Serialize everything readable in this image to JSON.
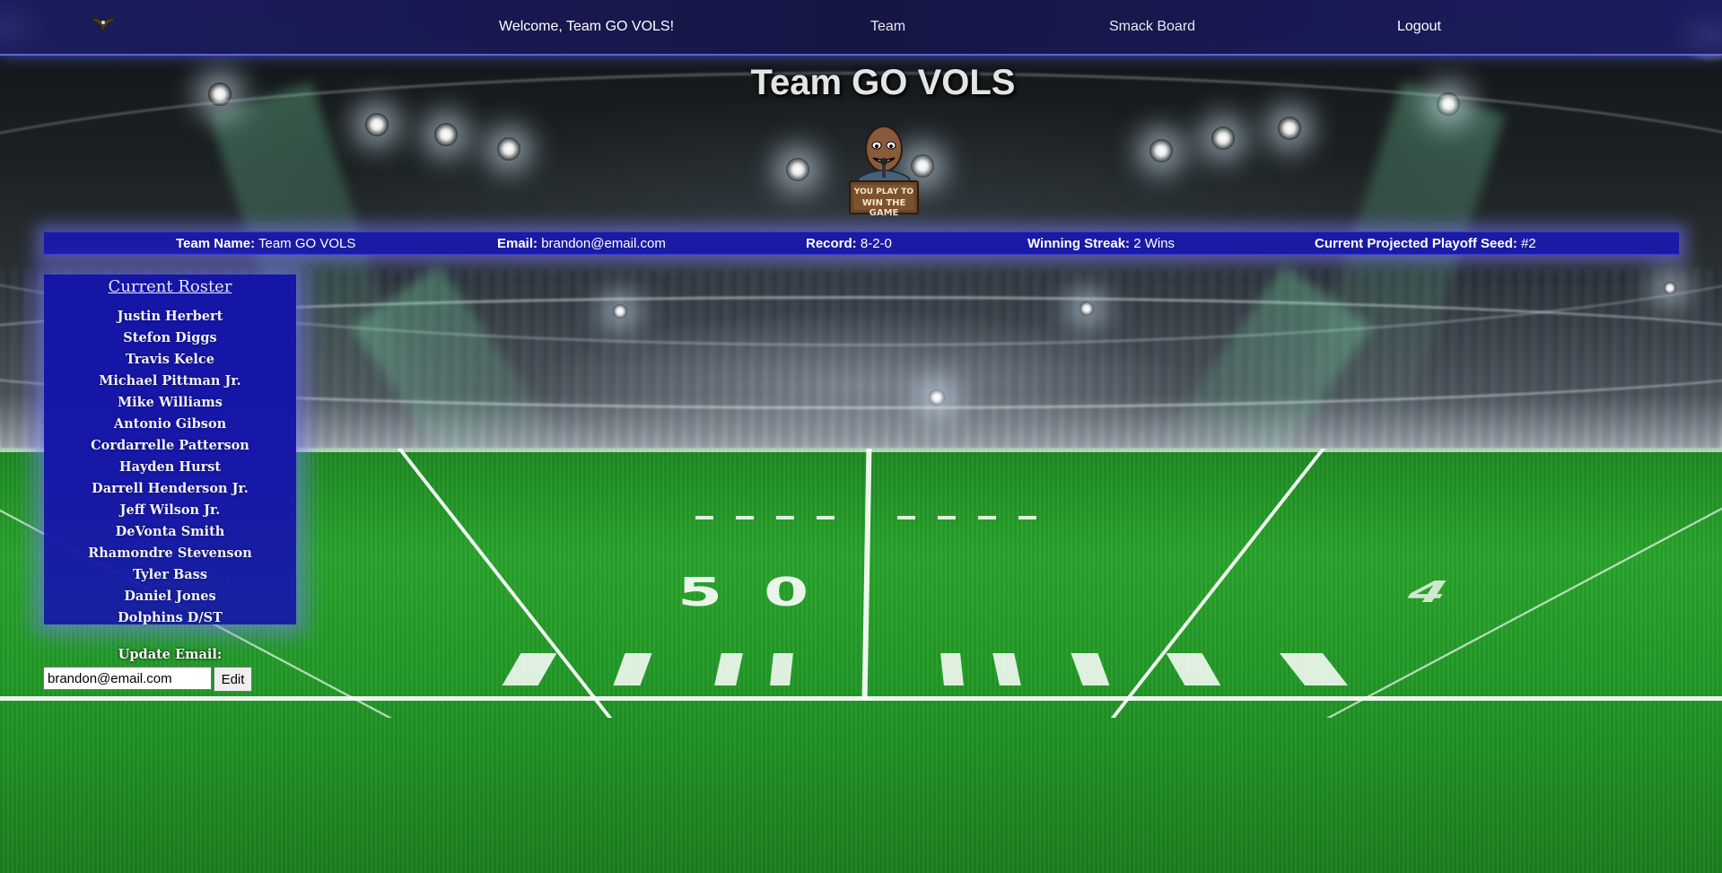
{
  "nav": {
    "welcome": "Welcome, Team GO VOLS!",
    "team_link": "Team",
    "smack_link": "Smack Board",
    "logout_link": "Logout",
    "logo_icon": "eagle-logo-icon"
  },
  "page": {
    "title": "Team GO VOLS",
    "mascot_sign_line1": "YOU PLAY TO",
    "mascot_sign_line2": "WIN THE GAME"
  },
  "info": {
    "team_name_label": "Team Name:",
    "team_name_value": "Team GO VOLS",
    "email_label": "Email:",
    "email_value": "brandon@email.com",
    "record_label": "Record:",
    "record_value": "8-2-0",
    "streak_label": "Winning Streak:",
    "streak_value": "2 Wins",
    "seed_label": "Current Projected Playoff Seed:",
    "seed_value": "#2"
  },
  "roster": {
    "title": "Current Roster",
    "players": [
      "Justin Herbert",
      "Stefon Diggs",
      "Travis Kelce",
      "Michael Pittman Jr.",
      "Mike Williams",
      "Antonio Gibson",
      "Cordarrelle Patterson",
      "Hayden Hurst",
      "Darrell Henderson Jr.",
      "Jeff Wilson Jr.",
      "DeVonta Smith",
      "Rhamondre Stevenson",
      "Tyler Bass",
      "Daniel Jones",
      "Dolphins D/ST"
    ]
  },
  "update_email": {
    "label": "Update Email:",
    "value": "brandon@email.com",
    "button": "Edit"
  },
  "field": {
    "yard_left": "50",
    "yard_right": "4"
  },
  "colors": {
    "nav_bg": "#1c1e64",
    "info_bar_bg": "#1a1aa4",
    "roster_bg": "#1616a6",
    "glow": "#7878ff",
    "field_green": "#2aa52c"
  }
}
